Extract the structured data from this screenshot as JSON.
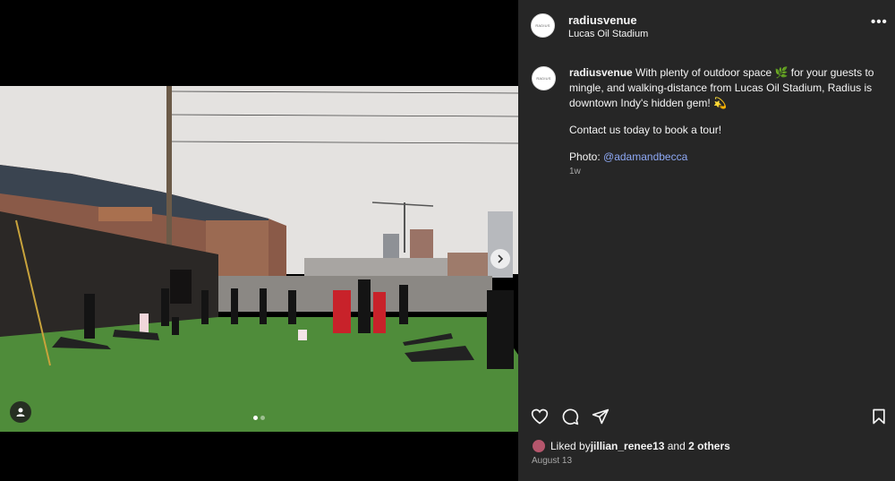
{
  "post": {
    "username": "radiusvenue",
    "location": "Lucas Oil Stadium",
    "avatar_label": "RADIUS",
    "caption_user": "radiusvenue",
    "caption_text": "With plenty of outdoor space 🌿 for your guests to mingle, and walking-distance from Lucas Oil Stadium, Radius is downtown Indy's hidden gem! 💫",
    "caption_cta": "Contact us today to book a tour!",
    "photo_prefix": "Photo: ",
    "photo_credit": "@adamandbecca",
    "time_ago": "1w",
    "liked_prefix": "Liked by ",
    "liked_user": "jillian_renee13",
    "liked_and": " and ",
    "liked_others": "2 others",
    "date": "August 13",
    "more_label": "•••"
  },
  "carousel": {
    "current": 1,
    "total": 2
  },
  "icons": {
    "like": "heart-icon",
    "comment": "comment-icon",
    "share": "share-icon",
    "save": "bookmark-icon",
    "next": "chevron-right-icon",
    "tag": "user-tag-icon"
  },
  "colors": {
    "panel": "#262626",
    "link": "#8ea9f5",
    "muted": "#a8a8a8"
  }
}
